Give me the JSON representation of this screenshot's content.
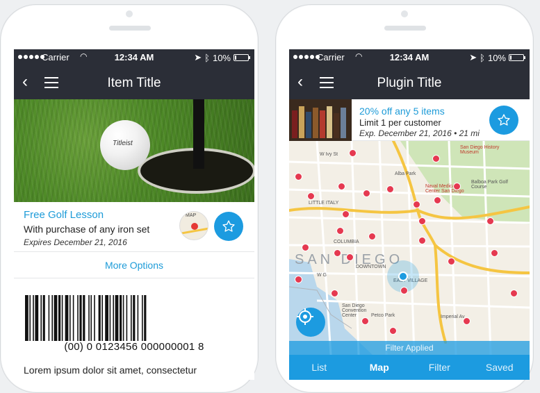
{
  "status": {
    "carrier": "Carrier",
    "time": "12:34 AM",
    "battery": "10%",
    "battery_level": 0.1
  },
  "left": {
    "nav_title": "Item Title",
    "ball_brand": "Titleist",
    "offer": {
      "title": "Free Golf Lesson",
      "description": "With purchase of any iron set",
      "expires": "Expires December 21, 2016",
      "map_thumb_label": "MAP"
    },
    "more_options": "More Options",
    "barcode_number": "(00) 0 0123456 000000001 8",
    "body_text": "Lorem ipsum dolor sit amet, consectetur"
  },
  "right": {
    "nav_title": "Plugin Title",
    "deal": {
      "title": "20% off any 5 items",
      "limit": "Limit 1 per customer",
      "expires": "Exp. December 21, 2016 • 21 mi"
    },
    "map": {
      "city_label": "SAN DIEGO",
      "labels": {
        "w_ivy": "W Ivy St",
        "san_diego_history": "San Diego History Museum",
        "alba_park": "Alba Park",
        "balboa_park": "Balboa Park Golf Course",
        "naval_medical": "Naval Medical Center San Diego",
        "little_italy": "LITTLE ITALY",
        "columbia": "COLUMBIA",
        "downtown": "DOWNTOWN",
        "east_village": "EAST VILLAGE",
        "w_g": "W G",
        "convention_center": "San Diego Convention Center",
        "petco_park": "Petco Park",
        "imperial": "Imperial Av"
      }
    },
    "filter_applied": "Filter Applied",
    "tabs": [
      "List",
      "Map",
      "Filter",
      "Saved"
    ],
    "active_tab": "Map"
  },
  "colors": {
    "accent": "#1c9be0",
    "nav": "#2b2e37",
    "pin": "#e53950"
  }
}
